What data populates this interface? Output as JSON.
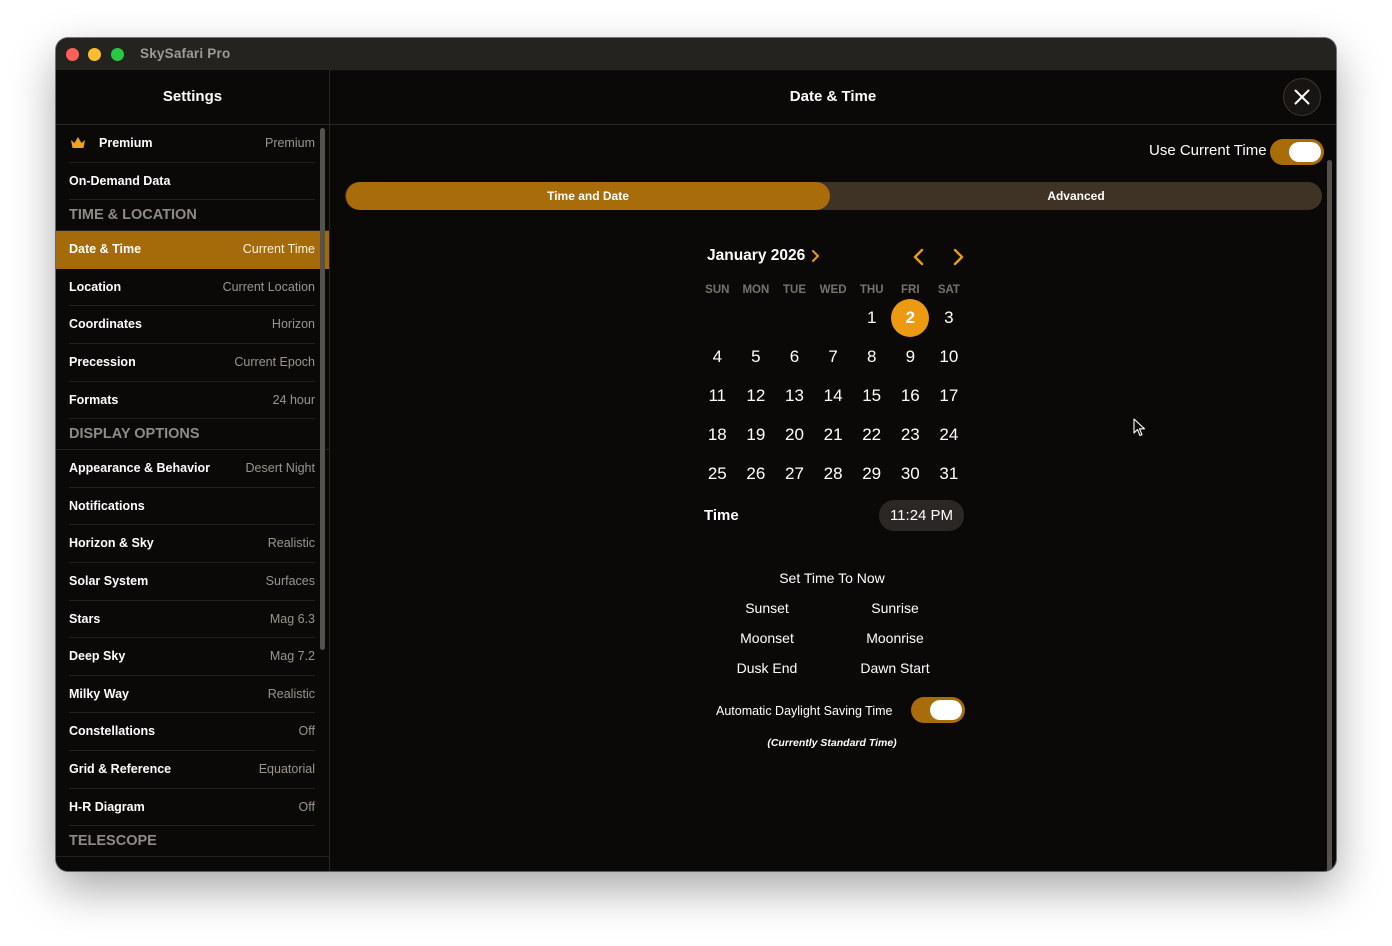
{
  "window": {
    "title": "SkySafari Pro"
  },
  "sidebar": {
    "title": "Settings",
    "top_items": [
      {
        "label": "Premium",
        "value": "Premium",
        "icon": "crown-icon"
      },
      {
        "label": "On-Demand Data",
        "value": ""
      }
    ],
    "sections": [
      {
        "title": "TIME & LOCATION",
        "items": [
          {
            "label": "Date & Time",
            "value": "Current Time",
            "active": true
          },
          {
            "label": "Location",
            "value": "Current Location"
          },
          {
            "label": "Coordinates",
            "value": "Horizon"
          },
          {
            "label": "Precession",
            "value": "Current Epoch"
          },
          {
            "label": "Formats",
            "value": "24 hour"
          }
        ]
      },
      {
        "title": "DISPLAY OPTIONS",
        "items": [
          {
            "label": "Appearance & Behavior",
            "value": "Desert Night"
          },
          {
            "label": "Notifications",
            "value": ""
          },
          {
            "label": "Horizon & Sky",
            "value": "Realistic"
          },
          {
            "label": "Solar System",
            "value": "Surfaces"
          },
          {
            "label": "Stars",
            "value": "Mag 6.3"
          },
          {
            "label": "Deep Sky",
            "value": "Mag 7.2"
          },
          {
            "label": "Milky Way",
            "value": "Realistic"
          },
          {
            "label": "Constellations",
            "value": "Off"
          },
          {
            "label": "Grid & Reference",
            "value": "Equatorial"
          },
          {
            "label": "H-R Diagram",
            "value": "Off"
          }
        ]
      },
      {
        "title": "TELESCOPE",
        "items": []
      }
    ]
  },
  "main": {
    "title": "Date & Time",
    "use_current_time": {
      "label": "Use Current Time",
      "on": true
    },
    "tabs": [
      {
        "label": "Time and Date",
        "active": true
      },
      {
        "label": "Advanced",
        "active": false
      }
    ],
    "calendar": {
      "month_label": "January 2026",
      "weekdays": [
        "SUN",
        "MON",
        "TUE",
        "WED",
        "THU",
        "FRI",
        "SAT"
      ],
      "first_weekday_index": 4,
      "days_in_month": 31,
      "selected_day": 2
    },
    "time": {
      "label": "Time",
      "value": "11:24 PM"
    },
    "set_time_to_now": {
      "title": "Set Time To Now",
      "buttons": [
        [
          "Sunset",
          "Sunrise"
        ],
        [
          "Moonset",
          "Moonrise"
        ],
        [
          "Dusk End",
          "Dawn Start"
        ]
      ]
    },
    "dst": {
      "label": "Automatic Daylight Saving Time",
      "on": true,
      "note": "(Currently Standard Time)"
    }
  },
  "colors": {
    "accent": "#a86c0a",
    "selected_day": "#ec9a12",
    "background": "#0b0907"
  }
}
